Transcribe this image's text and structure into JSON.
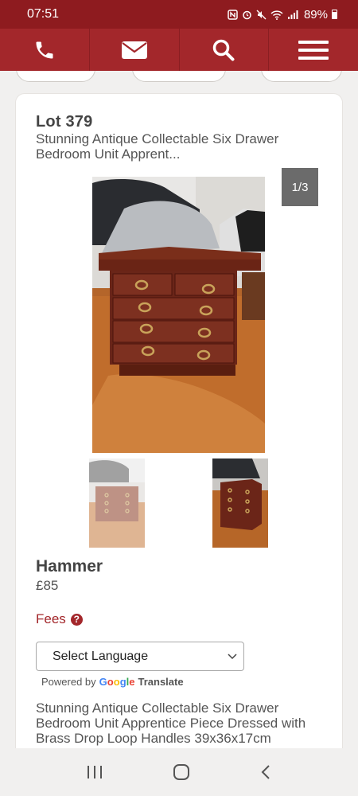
{
  "status_bar": {
    "time": "07:51",
    "battery": "89%",
    "icons": [
      "nfc-icon",
      "alarm-icon",
      "mute-icon",
      "wifi-icon",
      "signal-icon",
      "battery-icon"
    ]
  },
  "nav": {
    "items": [
      {
        "icon": "phone-icon"
      },
      {
        "icon": "mail-icon"
      },
      {
        "icon": "search-icon"
      },
      {
        "icon": "menu-icon"
      }
    ]
  },
  "lot": {
    "title": "Lot 379",
    "subtitle": "Stunning Antique Collectable Six Drawer Bedroom Unit Apprent...",
    "image_counter": "1/3"
  },
  "hammer": {
    "label": "Hammer",
    "price": "£85"
  },
  "fees": {
    "label": "Fees",
    "help_glyph": "?"
  },
  "translate": {
    "select_label": "Select Language",
    "powered_by": "Powered by",
    "google_letters": [
      "G",
      "o",
      "o",
      "g",
      "l",
      "e"
    ],
    "google_colors": [
      "#4285f4",
      "#ea4335",
      "#fbbc05",
      "#4285f4",
      "#34a853",
      "#ea4335"
    ],
    "translate_word": "Translate"
  },
  "description": "Stunning Antique Collectable Six Drawer Bedroom Unit Apprentice Piece Dressed with Brass Drop Loop Handles 39x36x17cm",
  "colors": {
    "status_bar": "#8e1b1f",
    "nav_bar": "#a3272b",
    "accent": "#a3272b"
  }
}
